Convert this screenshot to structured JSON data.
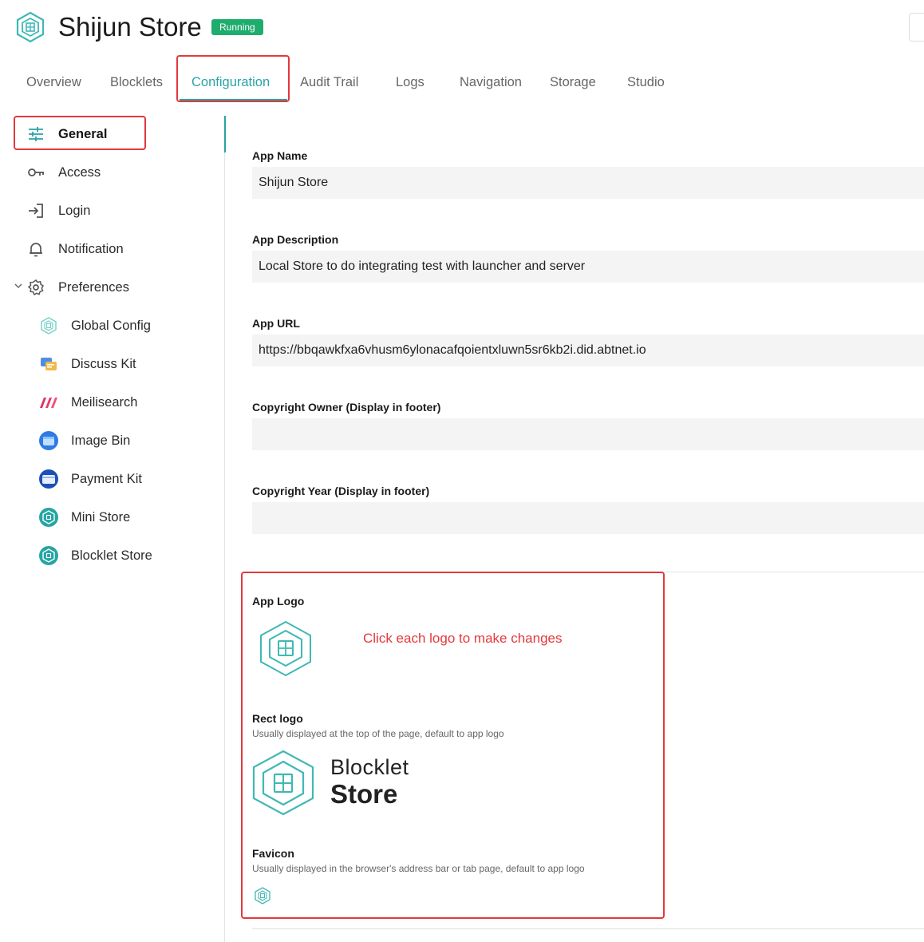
{
  "header": {
    "title": "Shijun Store",
    "status": "Running"
  },
  "tabs": [
    {
      "label": "Overview"
    },
    {
      "label": "Blocklets"
    },
    {
      "label": "Configuration",
      "active": true
    },
    {
      "label": "Audit Trail"
    },
    {
      "label": "Logs"
    },
    {
      "label": "Navigation"
    },
    {
      "label": "Storage"
    },
    {
      "label": "Studio"
    }
  ],
  "sidebar": {
    "items": [
      {
        "label": "General",
        "icon": "sliders-icon",
        "active": true
      },
      {
        "label": "Access",
        "icon": "key-icon"
      },
      {
        "label": "Login",
        "icon": "login-icon"
      },
      {
        "label": "Notification",
        "icon": "bell-icon"
      },
      {
        "label": "Preferences",
        "icon": "gear-icon",
        "expanded": true
      },
      {
        "label": "Global Config",
        "icon": "global-config-icon"
      },
      {
        "label": "Discuss Kit",
        "icon": "discuss-kit-icon"
      },
      {
        "label": "Meilisearch",
        "icon": "meilisearch-icon"
      },
      {
        "label": "Image Bin",
        "icon": "image-bin-icon"
      },
      {
        "label": "Payment Kit",
        "icon": "payment-kit-icon"
      },
      {
        "label": "Mini Store",
        "icon": "mini-store-icon"
      },
      {
        "label": "Blocklet Store",
        "icon": "blocklet-store-icon"
      }
    ]
  },
  "form": {
    "app_name": {
      "label": "App Name",
      "value": "Shijun Store"
    },
    "app_description": {
      "label": "App Description",
      "value": "Local Store to do integrating test with launcher and server"
    },
    "app_url": {
      "label": "App URL",
      "value": "https://bbqawkfxa6vhusm6ylonacafqoientxluwn5sr6kb2i.did.abtnet.io"
    },
    "copyright_owner": {
      "label": "Copyright Owner (Display in footer)",
      "value": ""
    },
    "copyright_year": {
      "label": "Copyright Year (Display in footer)",
      "value": ""
    }
  },
  "logos": {
    "hint": "Click each logo to make changes",
    "app_logo": {
      "label": "App Logo"
    },
    "rect_logo": {
      "label": "Rect logo",
      "desc": "Usually displayed at the top of the page, default to app logo",
      "text_line1": "Blocklet",
      "text_line2": "Store"
    },
    "favicon": {
      "label": "Favicon",
      "desc": "Usually displayed in the browser's address bar or tab page, default to app logo"
    }
  },
  "colors": {
    "accent": "#2aa3a6",
    "status": "#1ead6c",
    "highlight": "#e2393c"
  }
}
